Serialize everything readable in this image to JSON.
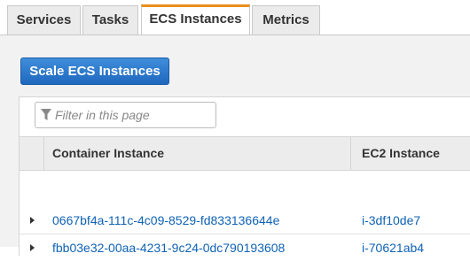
{
  "tabs": [
    {
      "label": "Services"
    },
    {
      "label": "Tasks"
    },
    {
      "label": "ECS Instances",
      "active": true
    },
    {
      "label": "Metrics"
    }
  ],
  "toolbar": {
    "scale_label": "Scale ECS Instances"
  },
  "filter": {
    "placeholder": "Filter in this page",
    "icon": "filter-icon"
  },
  "table": {
    "columns": [
      "Container Instance",
      "EC2 Instance"
    ],
    "rows": [
      {
        "container_instance": "0667bf4a-111c-4c09-8529-fd833136644e",
        "ec2_instance": "i-3df10de7"
      },
      {
        "container_instance": "fbb03e32-00aa-4231-9c24-0dc790193608",
        "ec2_instance": "i-70621ab4"
      }
    ]
  },
  "colors": {
    "accent": "#e88e1a",
    "button": "#1f68bf",
    "link": "#0f62b5"
  }
}
